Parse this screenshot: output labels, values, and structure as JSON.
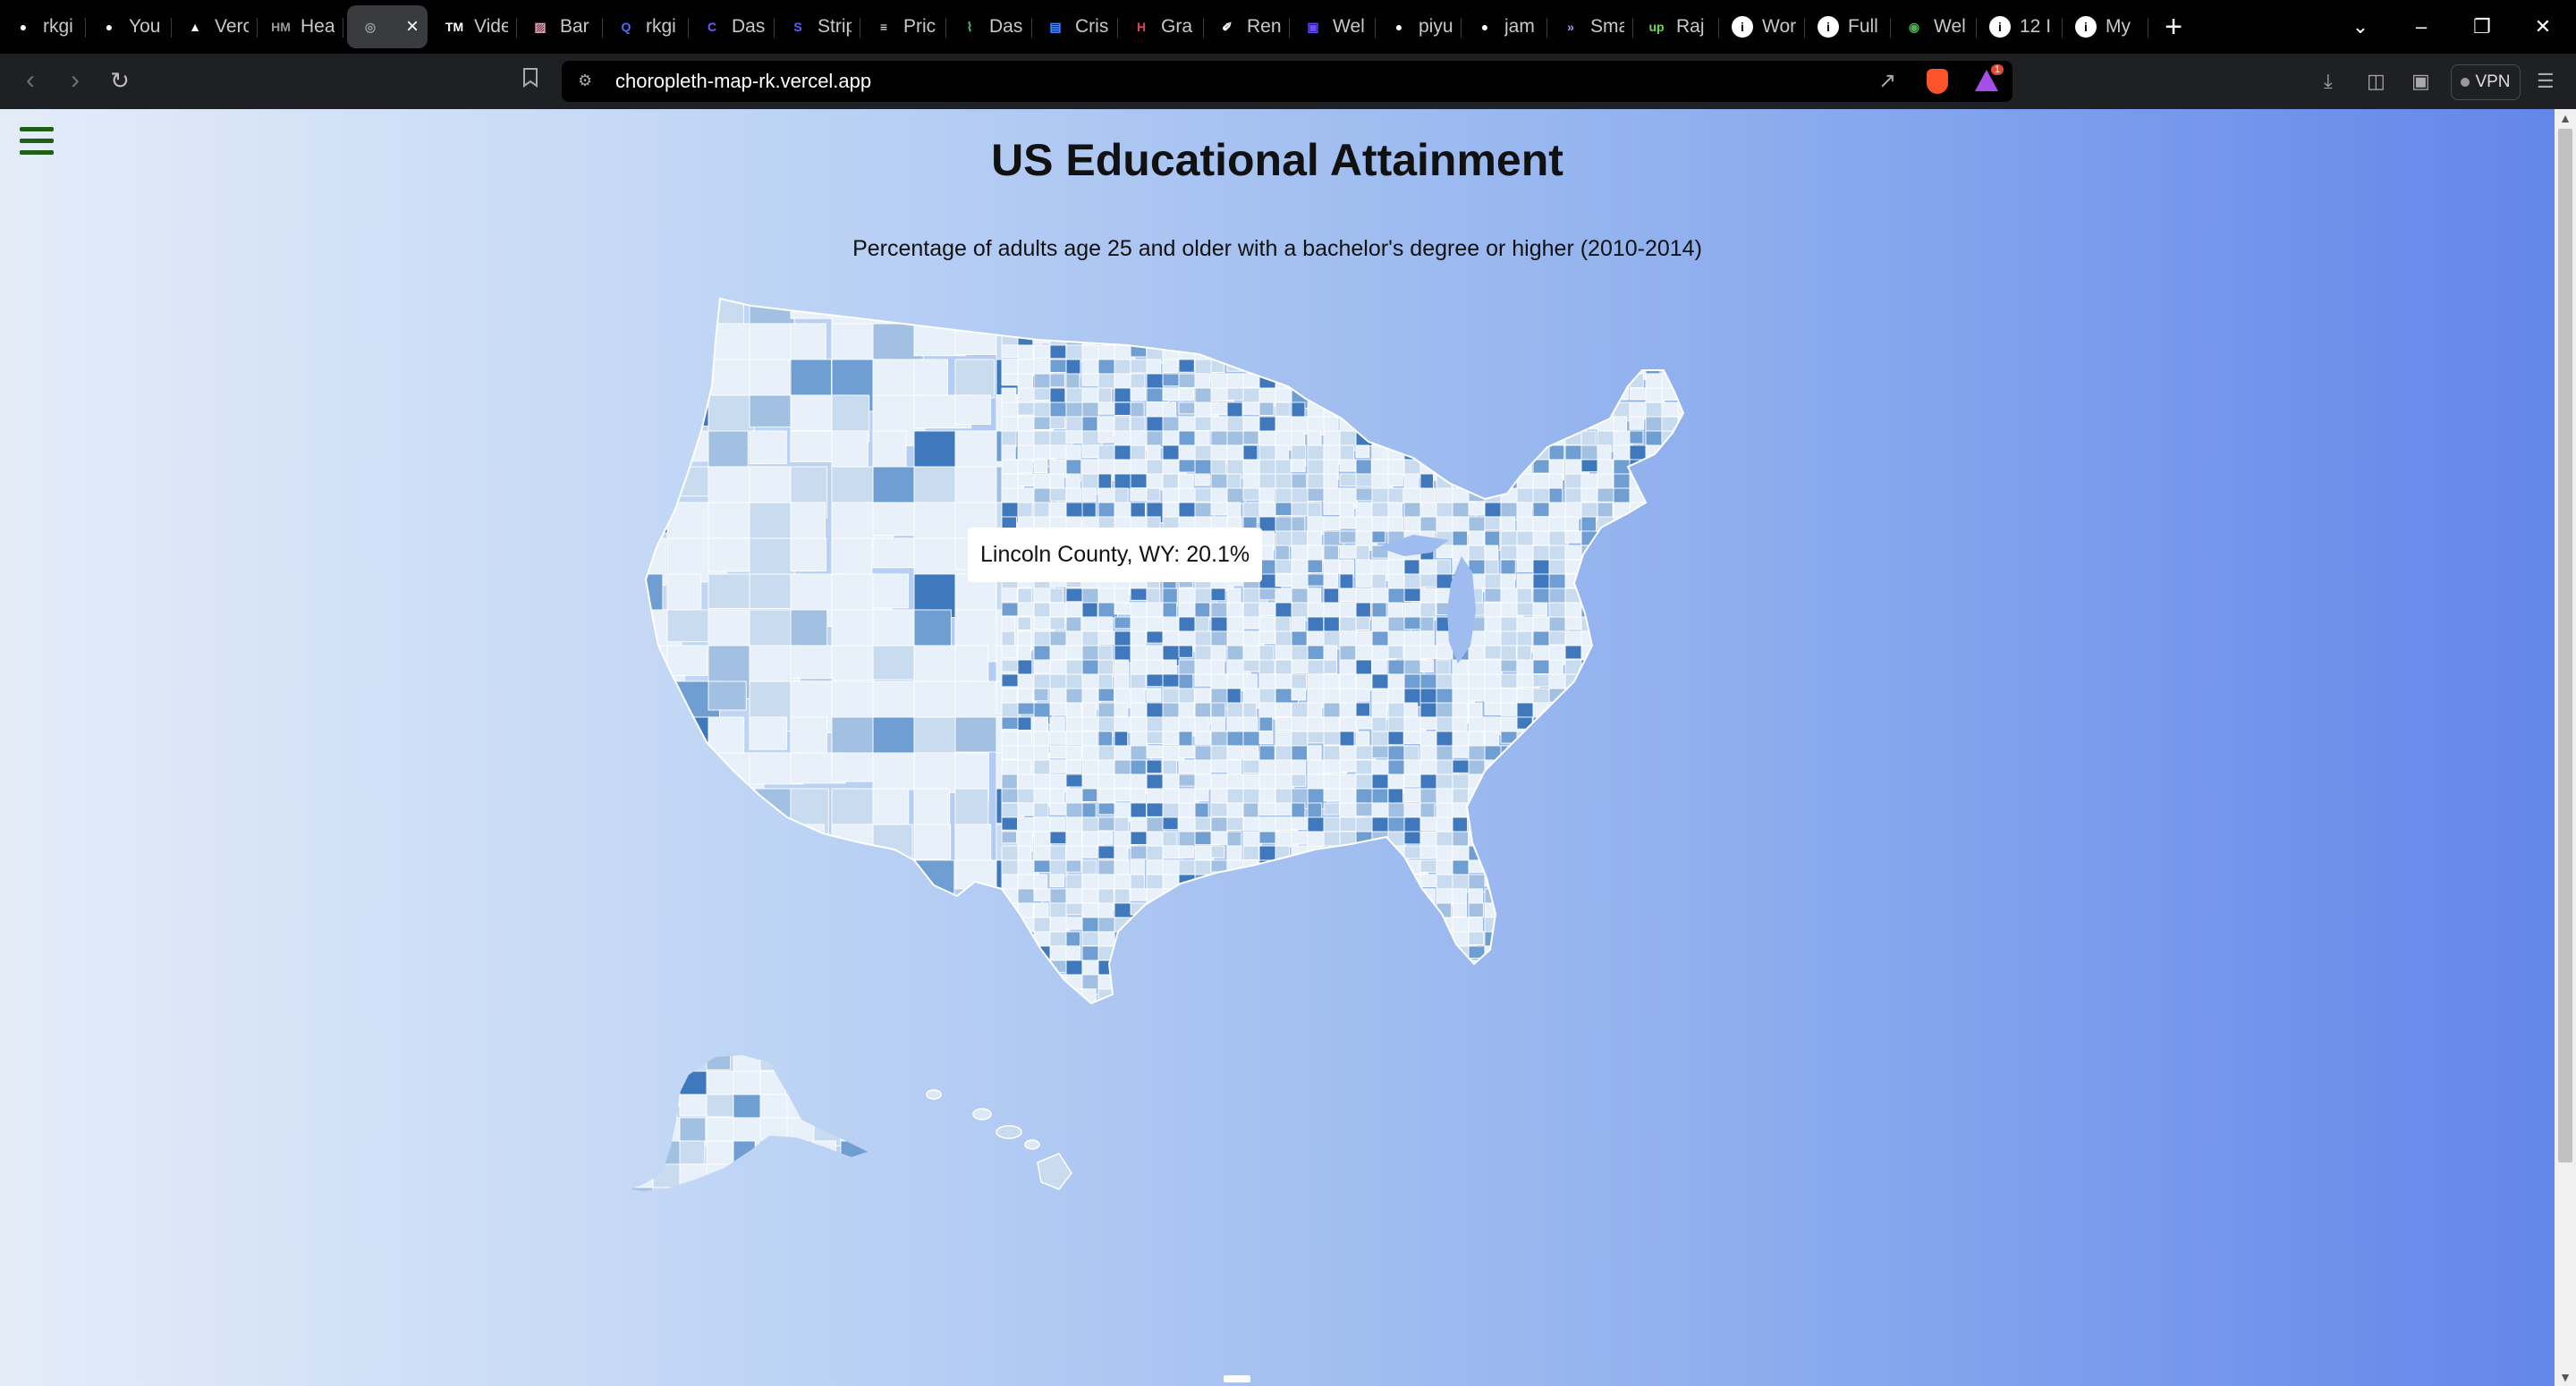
{
  "browser": {
    "tabs": [
      {
        "label": "rkgi",
        "icon": "github-icon",
        "icon_color": "#ffffff"
      },
      {
        "label": "You",
        "icon": "github-icon",
        "icon_color": "#ffffff"
      },
      {
        "label": "Verc",
        "icon": "vercel-icon",
        "icon_color": "#ffffff"
      },
      {
        "label": "Hea",
        "icon": "hm-icon",
        "icon_color": "#9a9a9a"
      },
      {
        "label": "",
        "icon": "globe-icon",
        "icon_color": "#9a9a9a",
        "active": true
      },
      {
        "label": "Vide",
        "icon": "tm-icon",
        "icon_color": "#ffffff"
      },
      {
        "label": "Bar",
        "icon": "chart-icon",
        "icon_color": "#e8a0c0"
      },
      {
        "label": "rkgi",
        "icon": "search-icon",
        "icon_color": "#4f6bff"
      },
      {
        "label": "Dasl",
        "icon": "c-icon",
        "icon_color": "#6a5cff"
      },
      {
        "label": "Strip",
        "icon": "stripe-icon",
        "icon_color": "#635bff"
      },
      {
        "label": "Pric",
        "icon": "bars-icon",
        "icon_color": "#ffffff"
      },
      {
        "label": "Dasl",
        "icon": "pulse-icon",
        "icon_color": "#3ecf8e"
      },
      {
        "label": "Cris",
        "icon": "doc-icon",
        "icon_color": "#4a8cff"
      },
      {
        "label": "Gra",
        "icon": "h-icon",
        "icon_color": "#e0445a"
      },
      {
        "label": "Ren",
        "icon": "render-icon",
        "icon_color": "#ffffff"
      },
      {
        "label": "Wel",
        "icon": "web-icon",
        "icon_color": "#6a4cff"
      },
      {
        "label": "piyu",
        "icon": "github-icon",
        "icon_color": "#ffffff"
      },
      {
        "label": "jam",
        "icon": "github-icon",
        "icon_color": "#ffffff"
      },
      {
        "label": "Sma",
        "icon": "chevrons-icon",
        "icon_color": "#8fa0ff"
      },
      {
        "label": "Raj",
        "icon": "upwork-icon",
        "icon_color": "#6fda44"
      },
      {
        "label": "Wor",
        "icon": "info-icon",
        "icon_color": "#ffffff"
      },
      {
        "label": "Full",
        "icon": "info-icon",
        "icon_color": "#ffffff"
      },
      {
        "label": "Wel",
        "icon": "chrome-icon",
        "icon_color": "#4caf50"
      },
      {
        "label": "12 I",
        "icon": "info-icon",
        "icon_color": "#ffffff"
      },
      {
        "label": "My",
        "icon": "info-icon",
        "icon_color": "#ffffff"
      }
    ],
    "url": "choropleth-map-rk.vercel.app",
    "vpn_label": "VPN",
    "notification_count": "1"
  },
  "page": {
    "title": "US Educational Attainment",
    "description": "Percentage of adults age 25 and older with a bachelor's degree or higher (2010-2014)",
    "tooltip": "Lincoln County, WY: 20.1%",
    "colors": {
      "lightest": "#e8f0f9",
      "light": "#c9dbef",
      "medium": "#a2c1e2",
      "dark": "#6f9fd2",
      "darkest": "#3f78bd",
      "menu_icon": "#1f5f16"
    }
  }
}
